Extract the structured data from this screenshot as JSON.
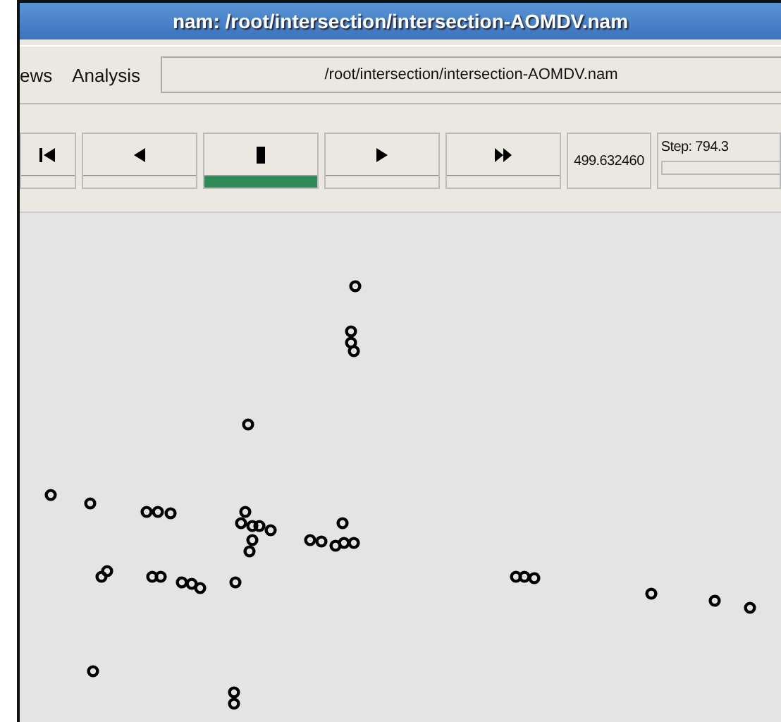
{
  "window": {
    "title": "nam: /root/intersection/intersection-AOMDV.nam"
  },
  "menu": [
    {
      "label": "ews"
    },
    {
      "label": "Analysis"
    }
  ],
  "file_path": "/root/intersection/intersection-AOMDV.nam",
  "transport": [
    {
      "kind": "rewind",
      "selected": false
    },
    {
      "kind": "back",
      "selected": false
    },
    {
      "kind": "stop",
      "selected": true
    },
    {
      "kind": "play",
      "selected": false
    },
    {
      "kind": "forward",
      "selected": false
    }
  ],
  "time": "499.632460",
  "step": "Step: 794.3"
}
